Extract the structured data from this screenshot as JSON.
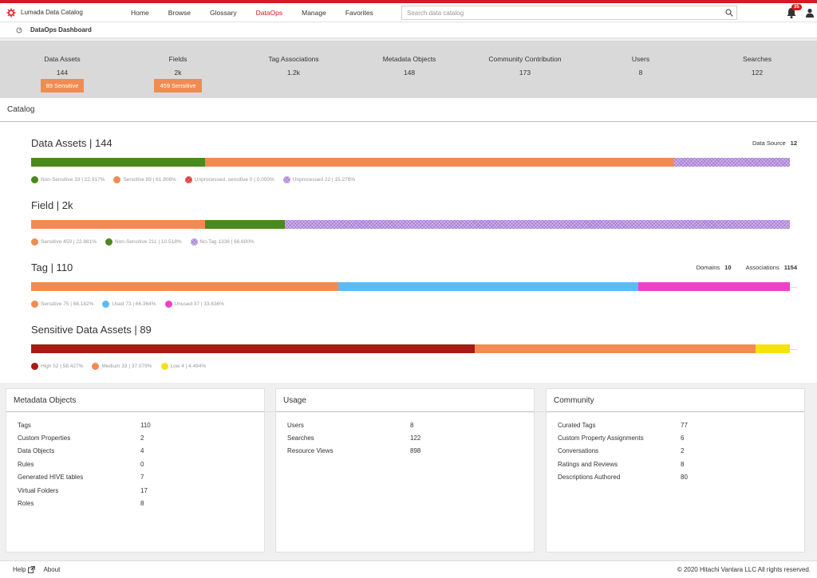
{
  "app": {
    "name": "Lumada Data Catalog"
  },
  "nav": [
    {
      "label": "Home",
      "active": false
    },
    {
      "label": "Browse",
      "active": false
    },
    {
      "label": "Glossary",
      "active": false
    },
    {
      "label": "DataOps",
      "active": true
    },
    {
      "label": "Manage",
      "active": false
    },
    {
      "label": "Favorites",
      "active": false
    }
  ],
  "search": {
    "placeholder": "Search data catalog"
  },
  "notifications": {
    "count": "35"
  },
  "subbar": {
    "title": "DataOps Dashboard"
  },
  "stats": [
    {
      "label": "Data Assets",
      "value": "144",
      "sensitive": "89 Sensitive"
    },
    {
      "label": "Fields",
      "value": "2k",
      "sensitive": "459 Sensitive"
    },
    {
      "label": "Tag Associations",
      "value": "1.2k"
    },
    {
      "label": "Metadata Objects",
      "value": "148"
    },
    {
      "label": "Community Contribution",
      "value": "173"
    },
    {
      "label": "Users",
      "value": "8"
    },
    {
      "label": "Searches",
      "value": "122"
    }
  ],
  "catalog": {
    "title": "Catalog",
    "data_assets": {
      "title": "Data Assets | 144",
      "right_label": "Data Source",
      "right_value": "12",
      "segments": [
        {
          "label": "Non-Sensitive 33 | 22.917%",
          "fraction": 0.22917,
          "color": "#4a8a1c",
          "pattern": false
        },
        {
          "label": "Sensitive 89 | 61.806%",
          "fraction": 0.61806,
          "color": "#f28b51",
          "pattern": false
        },
        {
          "label": "Unprocessed, sensitive 0 | 0.000%",
          "fraction": 0.0,
          "color": "#d71920",
          "pattern": true
        },
        {
          "label": "Unprocessed 22 | 15.278%",
          "fraction": 0.15278,
          "color": "#a67cd6",
          "pattern": true
        }
      ]
    },
    "field": {
      "title": "Field | 2k",
      "segments": [
        {
          "label": "Sensitive 459 | 22.881%",
          "fraction": 0.22881,
          "color": "#f28b51",
          "pattern": false
        },
        {
          "label": "Non-Sensitive 211 | 10.518%",
          "fraction": 0.10518,
          "color": "#4a8a1c",
          "pattern": false
        },
        {
          "label": "No-Tag 1336 | 66.600%",
          "fraction": 0.666,
          "color": "#a67cd6",
          "pattern": true
        }
      ]
    },
    "tag": {
      "title": "Tag | 110",
      "domains_label": "Domains",
      "domains_value": "10",
      "assoc_label": "Associations",
      "assoc_value": "1154",
      "segments": [
        {
          "label": "Sensitive 75 | 68.182%",
          "fraction": 0.405,
          "color": "#f28b51",
          "pattern": false
        },
        {
          "label": "Used 73 | 66.364%",
          "fraction": 0.395,
          "color": "#5bbcf5",
          "pattern": false
        },
        {
          "label": "Unused 37 | 33.636%",
          "fraction": 0.2,
          "color": "#f23fc9",
          "pattern": false
        }
      ]
    },
    "sensitive": {
      "title": "Sensitive Data Assets | 89",
      "segments": [
        {
          "label": "High 52 | 58.427%",
          "fraction": 0.58427,
          "color": "#a61b14",
          "pattern": false
        },
        {
          "label": "Medium 33 | 37.079%",
          "fraction": 0.37079,
          "color": "#f28b51",
          "pattern": false
        },
        {
          "label": "Low 4 | 4.494%",
          "fraction": 0.04494,
          "color": "#f5e20f",
          "pattern": false
        }
      ]
    }
  },
  "panels": {
    "metadata": {
      "title": "Metadata Objects",
      "rows": [
        {
          "k": "Tags",
          "v": "110"
        },
        {
          "k": "Custom Properties",
          "v": "2"
        },
        {
          "k": "Data Objects",
          "v": "4"
        },
        {
          "k": "Rules",
          "v": "0"
        },
        {
          "k": "Generated HIVE tables",
          "v": "7"
        },
        {
          "k": "Virtual Folders",
          "v": "17"
        },
        {
          "k": "Roles",
          "v": "8"
        }
      ]
    },
    "usage": {
      "title": "Usage",
      "rows": [
        {
          "k": "Users",
          "v": "8"
        },
        {
          "k": "Searches",
          "v": "122"
        },
        {
          "k": "Resource Views",
          "v": "898"
        }
      ]
    },
    "community": {
      "title": "Community",
      "rows": [
        {
          "k": "Curated Tags",
          "v": "77"
        },
        {
          "k": "Custom Property Assignments",
          "v": "6"
        },
        {
          "k": "Conversations",
          "v": "2"
        },
        {
          "k": "Ratings and Reviews",
          "v": "8"
        },
        {
          "k": "Descriptions Authored",
          "v": "80"
        }
      ]
    }
  },
  "footer": {
    "help": "Help",
    "about": "About",
    "copyright": "© 2020 Hitachi Vantara LLC All rights reserved."
  }
}
